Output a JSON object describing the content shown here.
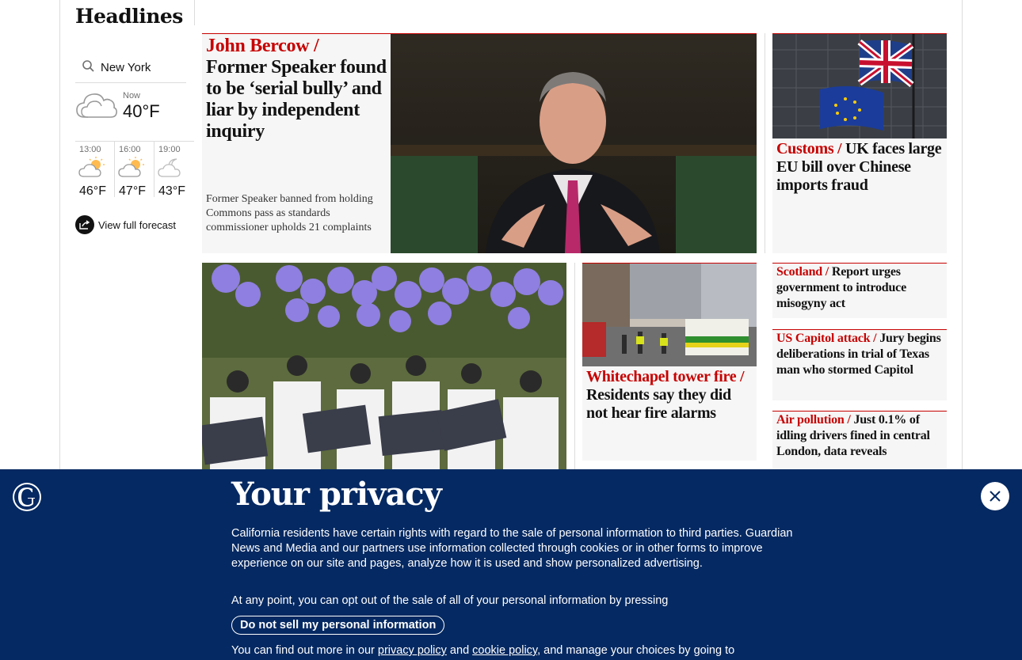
{
  "section": {
    "title": "Headlines"
  },
  "weather": {
    "location": "New York",
    "now_label": "Now",
    "now_temp": "40°F",
    "hours": [
      {
        "time": "13:00",
        "temp": "46°F",
        "icon": "partly-sunny-icon"
      },
      {
        "time": "16:00",
        "temp": "47°F",
        "icon": "partly-sunny-icon"
      },
      {
        "time": "19:00",
        "temp": "43°F",
        "icon": "moon-cloud-icon"
      }
    ],
    "forecast_link": "View full forecast"
  },
  "stories": {
    "main": {
      "kicker": "John Bercow /",
      "headline": "Former Speaker found to be ‘serial bully’ and liar by independent inquiry",
      "standfirst": "Former Speaker banned from holding Commons pass as standards commissioner upholds 21 complaints"
    },
    "customs": {
      "kicker": "Customs /",
      "headline": "UK faces large EU bill over Chinese imports fraud"
    },
    "whitechapel": {
      "kicker": "Whitechapel tower fire /",
      "headline": "Residents say they did not hear fire alarms"
    },
    "scotland": {
      "kicker": "Scotland /",
      "headline": "Report urges government to introduce misogyny act"
    },
    "capitol": {
      "kicker": "US Capitol attack /",
      "headline": "Jury begins deliberations in trial of Texas man who stormed Capitol"
    },
    "air": {
      "kicker": "Air pollution /",
      "headline": "Just 0.1% of idling drivers fined in central London, data reveals"
    }
  },
  "privacy": {
    "title": "Your privacy",
    "paragraph1": "California residents have certain rights with regard to the sale of personal information to third parties. Guardian News and Media and our partners use information collected through cookies or in other forms to improve experience on our site and pages, analyze how it is used and show personalized advertising.",
    "paragraph2": "At any point, you can opt out of the sale of all of your personal information by pressing",
    "button": "Do not sell my personal information",
    "p3_prefix": "You can find out more in our ",
    "privacy_link": "privacy policy",
    "and": " and ",
    "cookie_link": "cookie policy",
    "p3_suffix": ", and manage your choices by going to"
  },
  "colors": {
    "news_red": "#c70000",
    "guardian_blue": "#052962"
  }
}
